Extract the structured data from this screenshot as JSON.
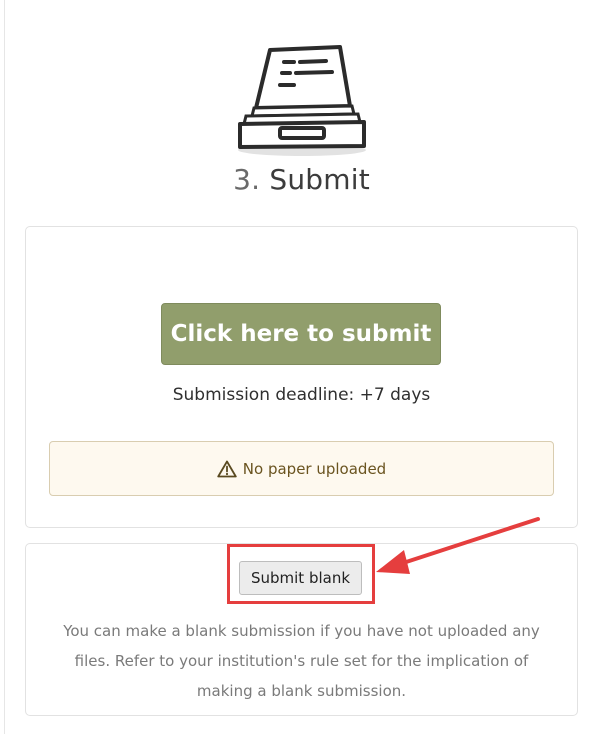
{
  "step": {
    "number": "3.",
    "title": "Submit",
    "icon": "file-tray-icon"
  },
  "submission": {
    "button_label": "Click here to submit",
    "deadline": "Submission deadline: +7 days",
    "warning_icon": "warning-triangle-icon",
    "warning": "No paper uploaded"
  },
  "blank": {
    "button_label": "Submit blank",
    "description": "You can make a blank submission if you have not uploaded any files. Refer to your institution's rule set for the implication of making a blank submission."
  },
  "annotation": {
    "color": "#e53e3e"
  },
  "colors": {
    "submit_button": "#919e6c",
    "warning_bg": "#fef9ef"
  }
}
